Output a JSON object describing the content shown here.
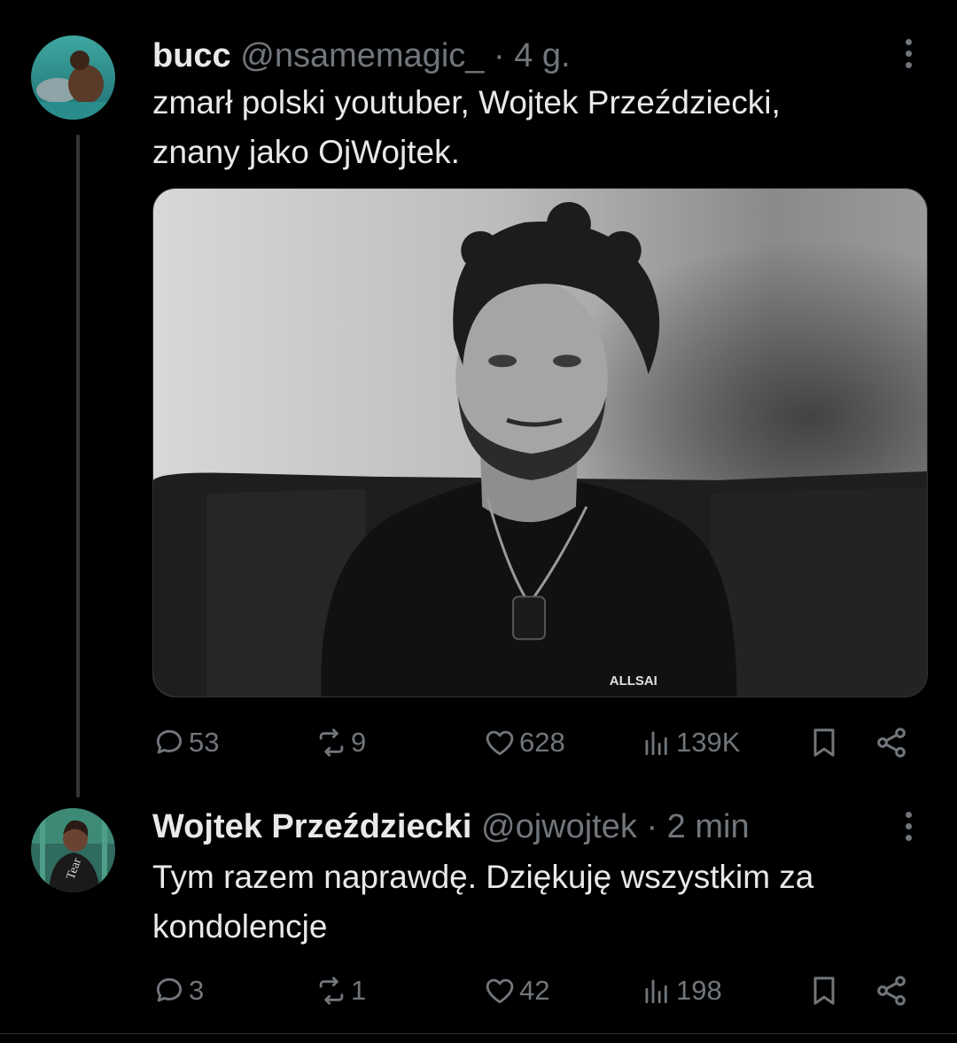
{
  "tweets": [
    {
      "author": {
        "name": "bucc",
        "handle": "@nsamemagic_",
        "avatar_icon": "avatar-photo"
      },
      "separator": "·",
      "time": "4 g.",
      "text_lines": [
        "zmarł polski youtuber, Wojtek Przeździecki,",
        "znany jako OjWojtek."
      ],
      "media": {
        "type": "photo",
        "shirt_text": "ALLSAI"
      },
      "stats": {
        "replies": "53",
        "reposts": "9",
        "likes": "628",
        "views": "139K"
      }
    },
    {
      "author": {
        "name": "Wojtek Przeździecki",
        "handle": "@ojwojtek",
        "avatar_icon": "avatar-photo"
      },
      "separator": "·",
      "time": "2 min",
      "text_lines": [
        "Tym razem naprawdę. Dziękuję wszystkim za",
        "kondolencje"
      ],
      "stats": {
        "replies": "3",
        "reposts": "1",
        "likes": "42",
        "views": "198"
      }
    }
  ],
  "colors": {
    "background": "#000000",
    "text_primary": "#e7e9ea",
    "text_secondary": "#71767b",
    "thread_line": "#333639"
  }
}
